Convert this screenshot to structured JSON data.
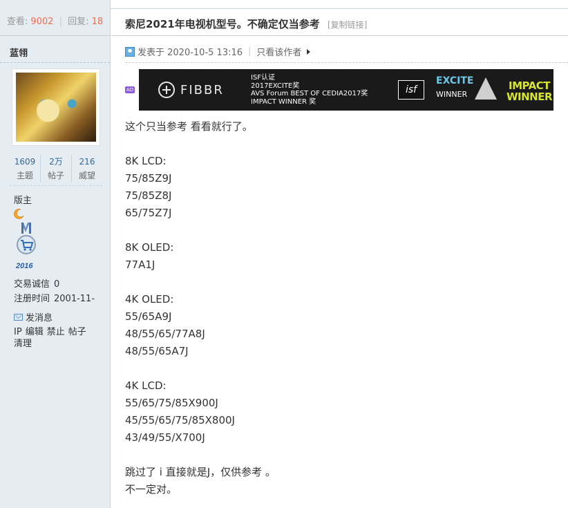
{
  "thread_stats": {
    "views_label": "查看:",
    "views": "9002",
    "replies_label": "回复:",
    "replies": "18"
  },
  "thread": {
    "title": "索尼2021年电视机型号。不确定仅当参考",
    "copy_link": "[复制链接]"
  },
  "author": {
    "name": "蓝翎",
    "stats": [
      {
        "value": "1609",
        "label": "主题"
      },
      {
        "value": "2万",
        "label": "帖子"
      },
      {
        "value": "216",
        "label": "威望"
      }
    ],
    "rank": "版主",
    "medal_year": "2016",
    "trade_label": "交易诚信",
    "trade_value": "0",
    "reg_label": "注册时间",
    "reg_value": "2001-11-",
    "send_msg": "发消息",
    "admin_links": [
      "IP",
      "编辑",
      "禁止",
      "帖子",
      "清理"
    ]
  },
  "post": {
    "posted_at": "发表于 2020-10-5 13:16",
    "only_author": "只看该作者"
  },
  "ad": {
    "badge": "AD",
    "brand": "FIBBR",
    "lines": [
      "ISF认证",
      "2017EXCITE奖",
      "AVS Forum BEST OF CEDIA2017奖",
      "IMPACT WINNER 奖"
    ],
    "isf_logo": "isf",
    "excite_top": "EXCITE",
    "excite_bottom": "WINNER",
    "impact_top": "IMPACT",
    "impact_bottom": "WINNER"
  },
  "content": {
    "lines": [
      "这个只当参考 看看就行了。",
      "",
      "8K LCD:",
      "75/85Z9J",
      "75/85Z8J",
      "65/75Z7J",
      "",
      "8K OLED:",
      "77A1J",
      "",
      "4K OLED:",
      "55/65A9J",
      "48/55/65/77A8J",
      "48/55/65A7J",
      "",
      "4K LCD:",
      "55/65/75/85X900J",
      "45/55/65/75/85X800J",
      "43/49/55/X700J",
      "",
      "跳过了 i 直接就是J，仅供参考 。",
      "不一定对。"
    ]
  }
}
